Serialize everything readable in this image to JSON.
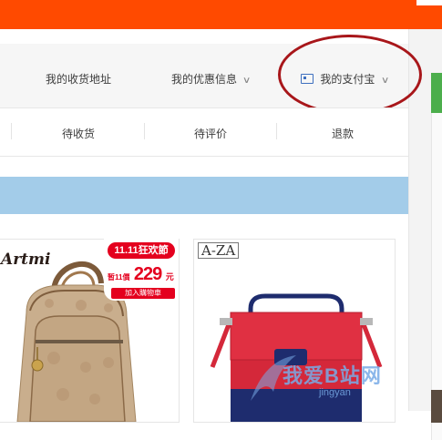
{
  "nav": {
    "items": [
      {
        "label": "我的收货地址"
      },
      {
        "label": "我的优惠信息"
      },
      {
        "label": "我的支付宝"
      }
    ]
  },
  "tabs": [
    {
      "label": "待收货"
    },
    {
      "label": "待评价"
    },
    {
      "label": "退款"
    }
  ],
  "products": {
    "card1": {
      "brand": "Artmi",
      "promo": {
        "tag": "11.11狂欢節",
        "pre": "暂11價",
        "price": "229",
        "unit": "元",
        "cart": "加入購物車"
      }
    },
    "card2": {
      "brand": "A-ZA"
    }
  },
  "watermark": {
    "text": "我爱B站网",
    "sub": "jingyan"
  },
  "colors": {
    "topbar": "#ff4a00",
    "banner": "#a3cce9",
    "annotation": "#a8161a",
    "promo": "#e4001e",
    "product_red": "#d4283a",
    "product_navy": "#1e2c6e",
    "bag_tan": "#c9ae8d"
  }
}
